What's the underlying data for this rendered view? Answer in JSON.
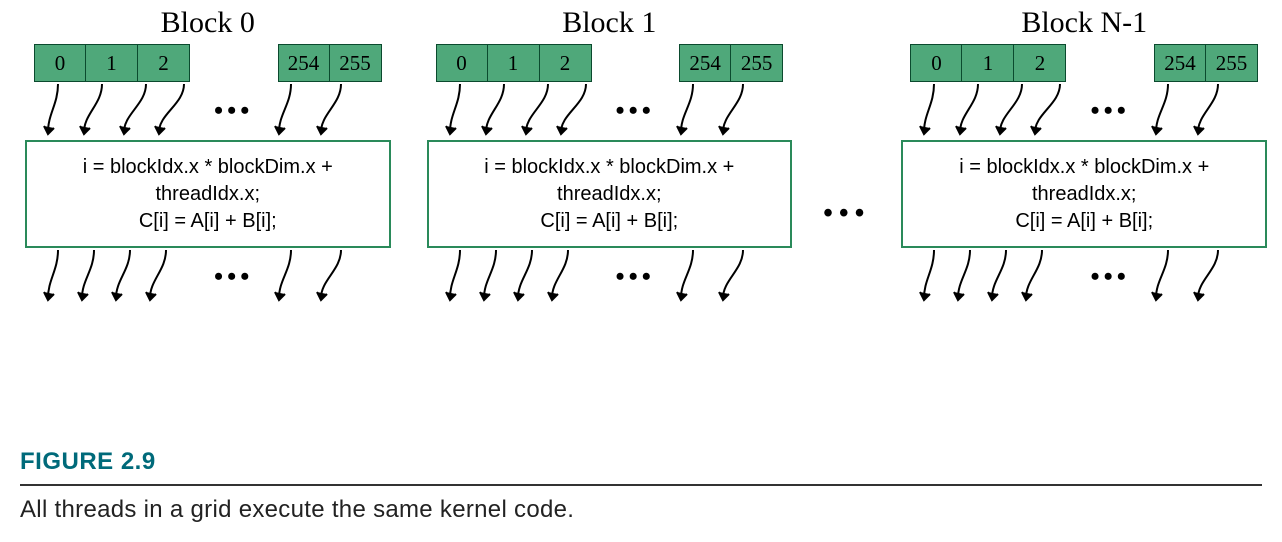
{
  "figure": {
    "label": "FIGURE 2.9",
    "caption": "All threads in a grid execute the same kernel code."
  },
  "kernel_code": {
    "line1": "i = blockIdx.x * blockDim.x +",
    "line2": "threadIdx.x;",
    "line3": "C[i] = A[i] + B[i];"
  },
  "ellipsis": "•••",
  "blocks": [
    {
      "title": "Block 0",
      "left_threads": [
        "0",
        "1",
        "2"
      ],
      "right_threads": [
        "254",
        "255"
      ]
    },
    {
      "title": "Block 1",
      "left_threads": [
        "0",
        "1",
        "2"
      ],
      "right_threads": [
        "254",
        "255"
      ]
    },
    {
      "title": "Block N-1",
      "left_threads": [
        "0",
        "1",
        "2"
      ],
      "right_threads": [
        "254",
        "255"
      ]
    }
  ]
}
